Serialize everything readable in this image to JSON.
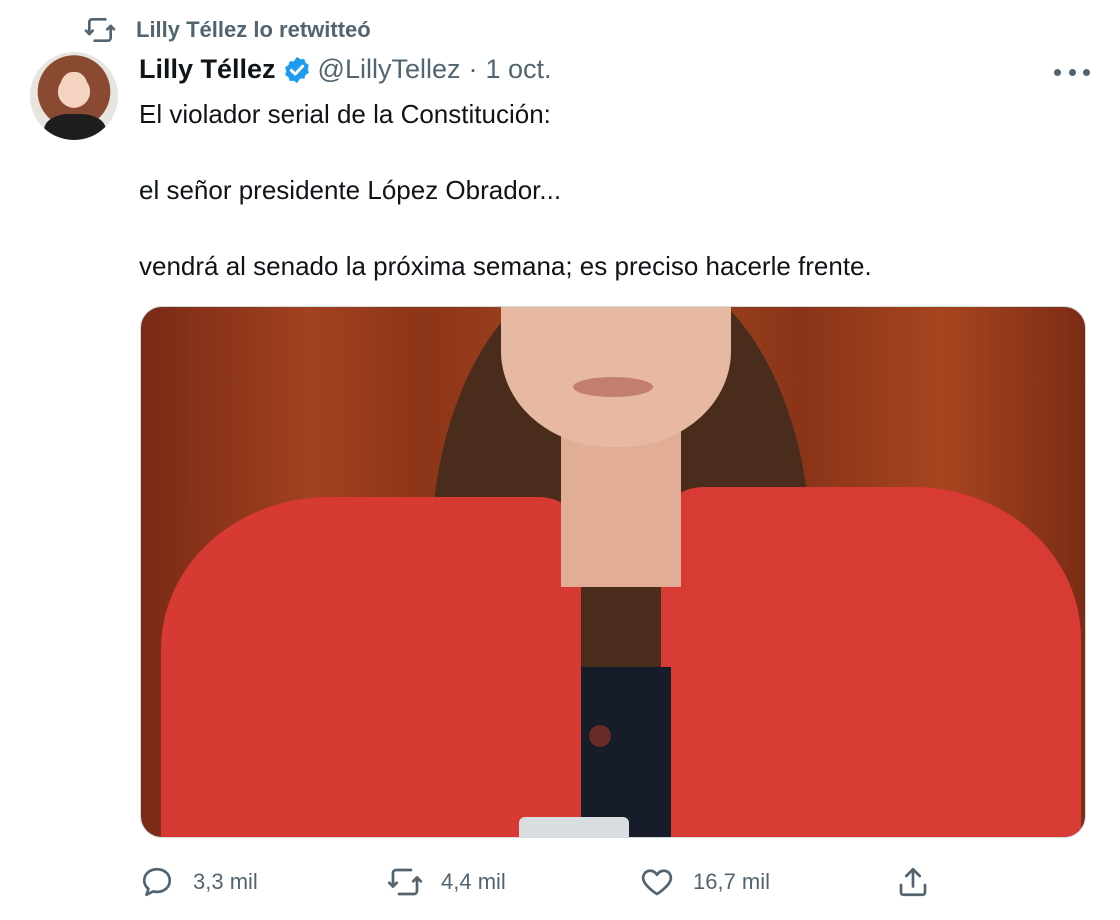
{
  "retweet_banner": {
    "text": "Lilly Téllez lo retwitteó",
    "icon": "retweet-icon"
  },
  "tweet": {
    "author_name": "Lilly Téllez",
    "verified_icon": "verified-badge-icon",
    "handle": "@LillyTellez",
    "separator": "·",
    "date": "1 oct.",
    "more_icon": "more-options-icon",
    "paragraphs": [
      "El violador serial de la Constitución:",
      "el señor presidente López Obrador...",
      "vendrá al senado la próxima semana; es preciso hacerle frente."
    ],
    "media": {
      "kind": "photo",
      "alt_subject": "woman in red jacket"
    }
  },
  "actions": {
    "reply": {
      "icon": "reply-icon",
      "count": "3,3 mil"
    },
    "retweet": {
      "icon": "retweet-icon",
      "count": "4,4 mil"
    },
    "like": {
      "icon": "heart-icon",
      "count": "16,7 mil"
    },
    "share": {
      "icon": "share-icon"
    }
  },
  "colors": {
    "text": "#0f1419",
    "muted": "#536471",
    "verified": "#1d9bf0",
    "border": "#cfd9de"
  }
}
